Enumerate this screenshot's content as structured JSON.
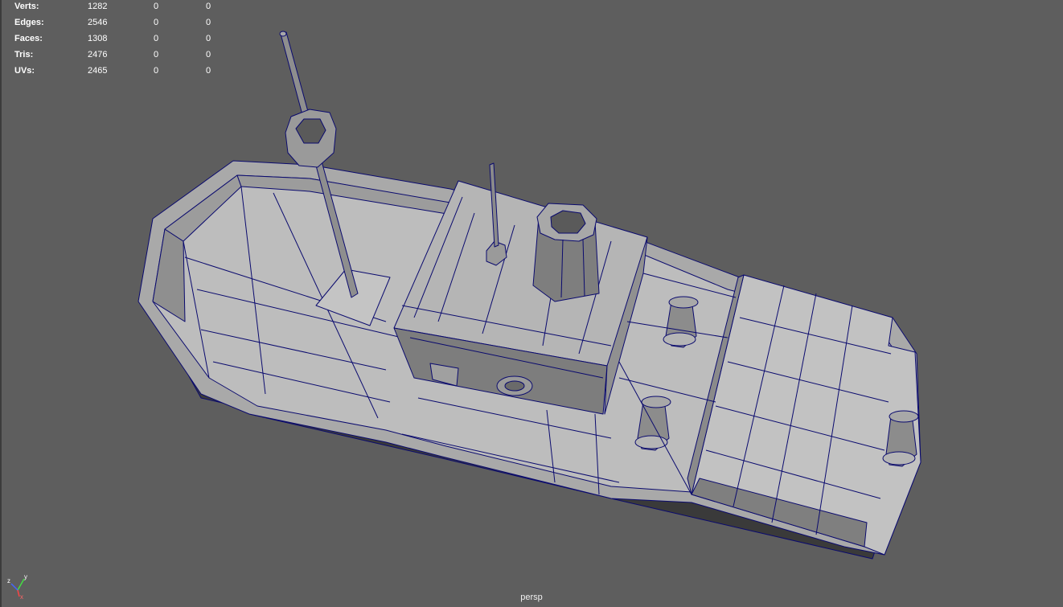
{
  "hud": {
    "rows": [
      {
        "label": "Verts:",
        "v1": "1282",
        "v2": "0",
        "v3": "0"
      },
      {
        "label": "Edges:",
        "v1": "2546",
        "v2": "0",
        "v3": "0"
      },
      {
        "label": "Faces:",
        "v1": "1308",
        "v2": "0",
        "v3": "0"
      },
      {
        "label": "Tris:",
        "v1": "2476",
        "v2": "0",
        "v3": "0"
      },
      {
        "label": "UVs:",
        "v1": "2465",
        "v2": "0",
        "v3": "0"
      }
    ]
  },
  "viewport": {
    "camera_label": "persp",
    "background_color": "#5e5e5e",
    "wire_color": "#0a0a6e",
    "mesh_color": "#b7b7b7"
  },
  "axis_gizmo": {
    "x": "x",
    "y": "y",
    "z": "z"
  }
}
